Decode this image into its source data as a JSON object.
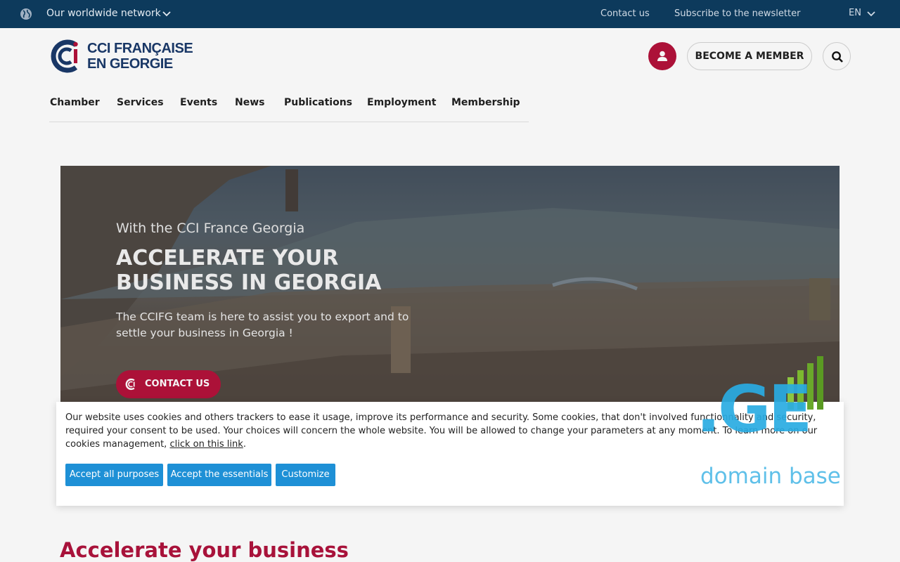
{
  "topbar": {
    "network_label": "Our worldwide network",
    "contact_label": "Contact us",
    "newsletter_label": "Subscribe to the newsletter",
    "language": "EN",
    "globe_icon": "globe-icon",
    "chevron_icon": "chevron-down-icon"
  },
  "header": {
    "logo_line1": "CCI FRANÇAISE",
    "logo_line2": "EN GEORGIE",
    "member_label": "BECOME A MEMBER",
    "user_icon": "user-icon",
    "search_icon": "search-icon"
  },
  "nav": {
    "items": [
      {
        "label": "Chamber"
      },
      {
        "label": "Services"
      },
      {
        "label": "Events"
      },
      {
        "label": "News"
      },
      {
        "label": "Publications"
      },
      {
        "label": "Employment"
      },
      {
        "label": "Membership"
      }
    ]
  },
  "hero": {
    "pretitle": "With the CCI France Georgia",
    "title": "ACCELERATE YOUR BUSINESS IN GEORGIA",
    "description": "The CCIFG team is here to assist you to export and to settle your business in Georgia !",
    "cta_label": "CONTACT US"
  },
  "cookie": {
    "text": "Our website uses cookies and others trackers to ease it usage, improve its performance and security. Some cookies, that don't involved functionnality and security, required your consent to be used. Your choices will concern the whole website. You will be allowed to change your parameters at any moment. To learn more on our cookies management, ",
    "link_text": "click on this link",
    "text_end": ".",
    "accept_all": "Accept all purposes",
    "accept_essentials": "Accept the essentials",
    "customize": "Customize"
  },
  "watermark": {
    "big": ".GE",
    "sub": "domain base"
  },
  "section": {
    "title": "Accelerate your business"
  },
  "colors": {
    "topbar_bg": "#0d3a5c",
    "brand_red": "#b3123b",
    "cookie_button": "#1e90d6",
    "watermark_blue": "#29abe2"
  }
}
